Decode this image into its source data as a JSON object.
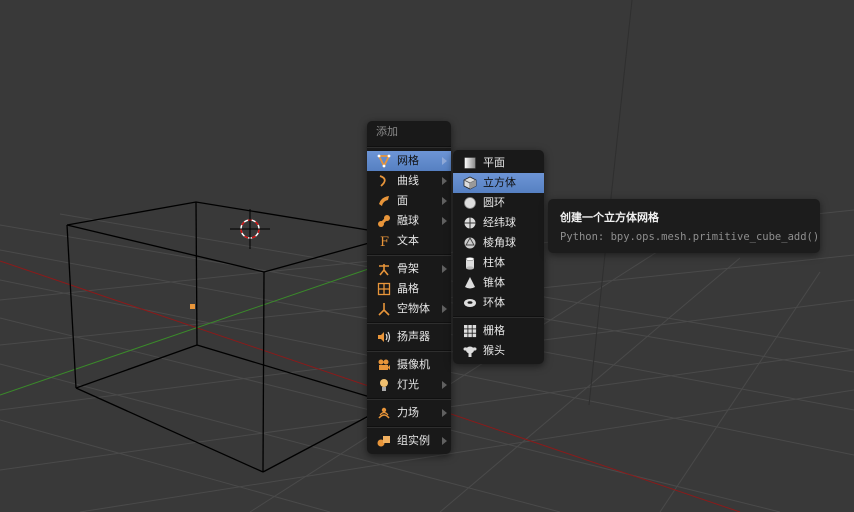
{
  "add_menu": {
    "title": "添加",
    "groups": [
      [
        {
          "label": "网格",
          "icon": "mesh-icon",
          "submenu": true,
          "active": true
        },
        {
          "label": "曲线",
          "icon": "curve-icon",
          "submenu": true
        },
        {
          "label": "面",
          "icon": "surface-icon",
          "submenu": true
        },
        {
          "label": "融球",
          "icon": "metaball-icon",
          "submenu": true
        },
        {
          "label": "文本",
          "icon": "text-icon",
          "submenu": false
        }
      ],
      [
        {
          "label": "骨架",
          "icon": "armature-icon",
          "submenu": true
        },
        {
          "label": "晶格",
          "icon": "lattice-icon",
          "submenu": false
        },
        {
          "label": "空物体",
          "icon": "empty-icon",
          "submenu": true
        }
      ],
      [
        {
          "label": "扬声器",
          "icon": "speaker-icon",
          "submenu": false
        }
      ],
      [
        {
          "label": "摄像机",
          "icon": "camera-icon",
          "submenu": false
        },
        {
          "label": "灯光",
          "icon": "lamp-icon",
          "submenu": true
        }
      ],
      [
        {
          "label": "力场",
          "icon": "force-field-icon",
          "submenu": true
        }
      ],
      [
        {
          "label": "组实例",
          "icon": "group-instance-icon",
          "submenu": true
        }
      ]
    ]
  },
  "mesh_menu": {
    "groups": [
      [
        {
          "label": "平面",
          "icon": "plane-icon"
        },
        {
          "label": "立方体",
          "icon": "cube-icon",
          "active": true
        },
        {
          "label": "圆环",
          "icon": "circle-icon"
        },
        {
          "label": "经纬球",
          "icon": "uv-sphere-icon"
        },
        {
          "label": "棱角球",
          "icon": "ico-sphere-icon"
        },
        {
          "label": "柱体",
          "icon": "cylinder-icon"
        },
        {
          "label": "锥体",
          "icon": "cone-icon"
        },
        {
          "label": "环体",
          "icon": "torus-icon"
        }
      ],
      [
        {
          "label": "栅格",
          "icon": "grid-icon"
        },
        {
          "label": "猴头",
          "icon": "monkey-icon"
        }
      ]
    ]
  },
  "tooltip": {
    "title": "创建一个立方体网格",
    "python": "Python: bpy.ops.mesh.primitive_cube_add()"
  },
  "colors": {
    "background": "#393939",
    "highlight": "#5680c2",
    "x_axis": "#8b1a1a",
    "y_axis": "#3a8a2a",
    "icon_orange": "#e8953a"
  }
}
